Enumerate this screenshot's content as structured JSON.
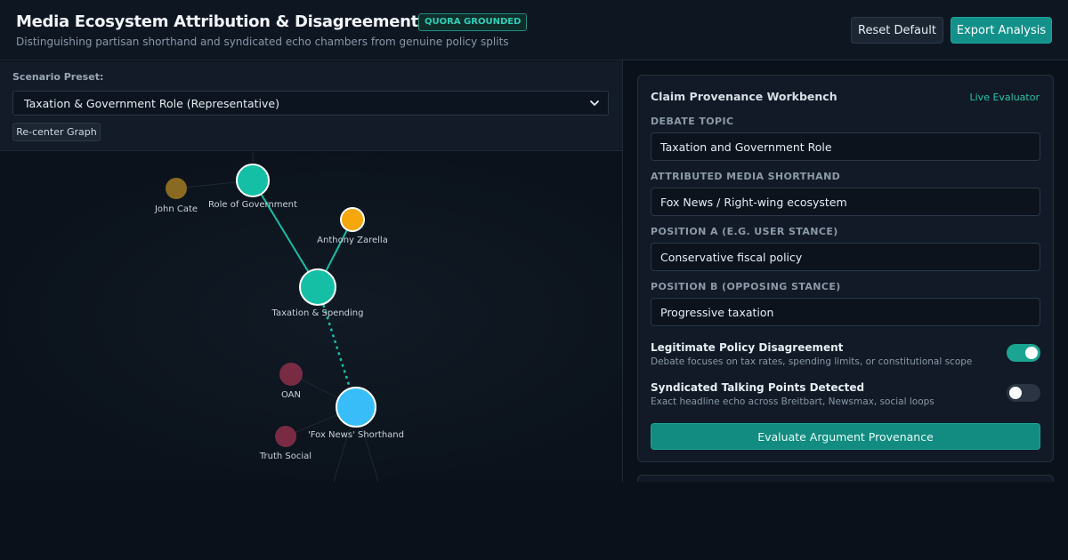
{
  "header": {
    "title": "Media Ecosystem Attribution & Disagreement Analyzer",
    "badge": "QUORA GROUNDED",
    "subtitle": "Distinguishing partisan shorthand and syndicated echo chambers from genuine policy splits",
    "reset_label": "Reset Default",
    "export_label": "Export Analysis"
  },
  "controls": {
    "preset_label": "Scenario Preset:",
    "preset_value": "Taxation & Government Role (Representative)",
    "recenter_label": "Re-center Graph"
  },
  "graph": {
    "nodes": {
      "john_cate": "John Cate",
      "role_of_government": "Role of Government",
      "anthony_zarella": "Anthony Zarella",
      "taxation_spending": "Taxation & Spending",
      "oan": "OAN",
      "fox_news_shorthand": "'Fox News' Shorthand",
      "truth_social": "Truth Social"
    },
    "colors": {
      "topic": "#14bfa6",
      "user": "#f5a70b",
      "muted_user": "#8a6a22",
      "outlet": "#38bdf8",
      "muted_outlet": "#7a2b44"
    }
  },
  "workbench": {
    "title": "Claim Provenance Workbench",
    "live": "Live Evaluator",
    "debate_topic_label": "DEBATE TOPIC",
    "debate_topic_value": "Taxation and Government Role",
    "shorthand_label": "ATTRIBUTED MEDIA SHORTHAND",
    "shorthand_value": "Fox News / Right-wing ecosystem",
    "position_a_label": "POSITION A (E.G. USER STANCE)",
    "position_a_value": "Conservative fiscal policy",
    "position_b_label": "POSITION B (OPPOSING STANCE)",
    "position_b_value": "Progressive taxation",
    "toggle1_title": "Legitimate Policy Disagreement",
    "toggle1_desc": "Debate focuses on tax rates, spending limits, or constitutional scope",
    "toggle1_on": true,
    "toggle2_title": "Syndicated Talking Points Detected",
    "toggle2_desc": "Exact headline echo across Breitbart, Newsmax, social loops",
    "toggle2_on": false,
    "evaluate_label": "Evaluate Argument Provenance"
  }
}
